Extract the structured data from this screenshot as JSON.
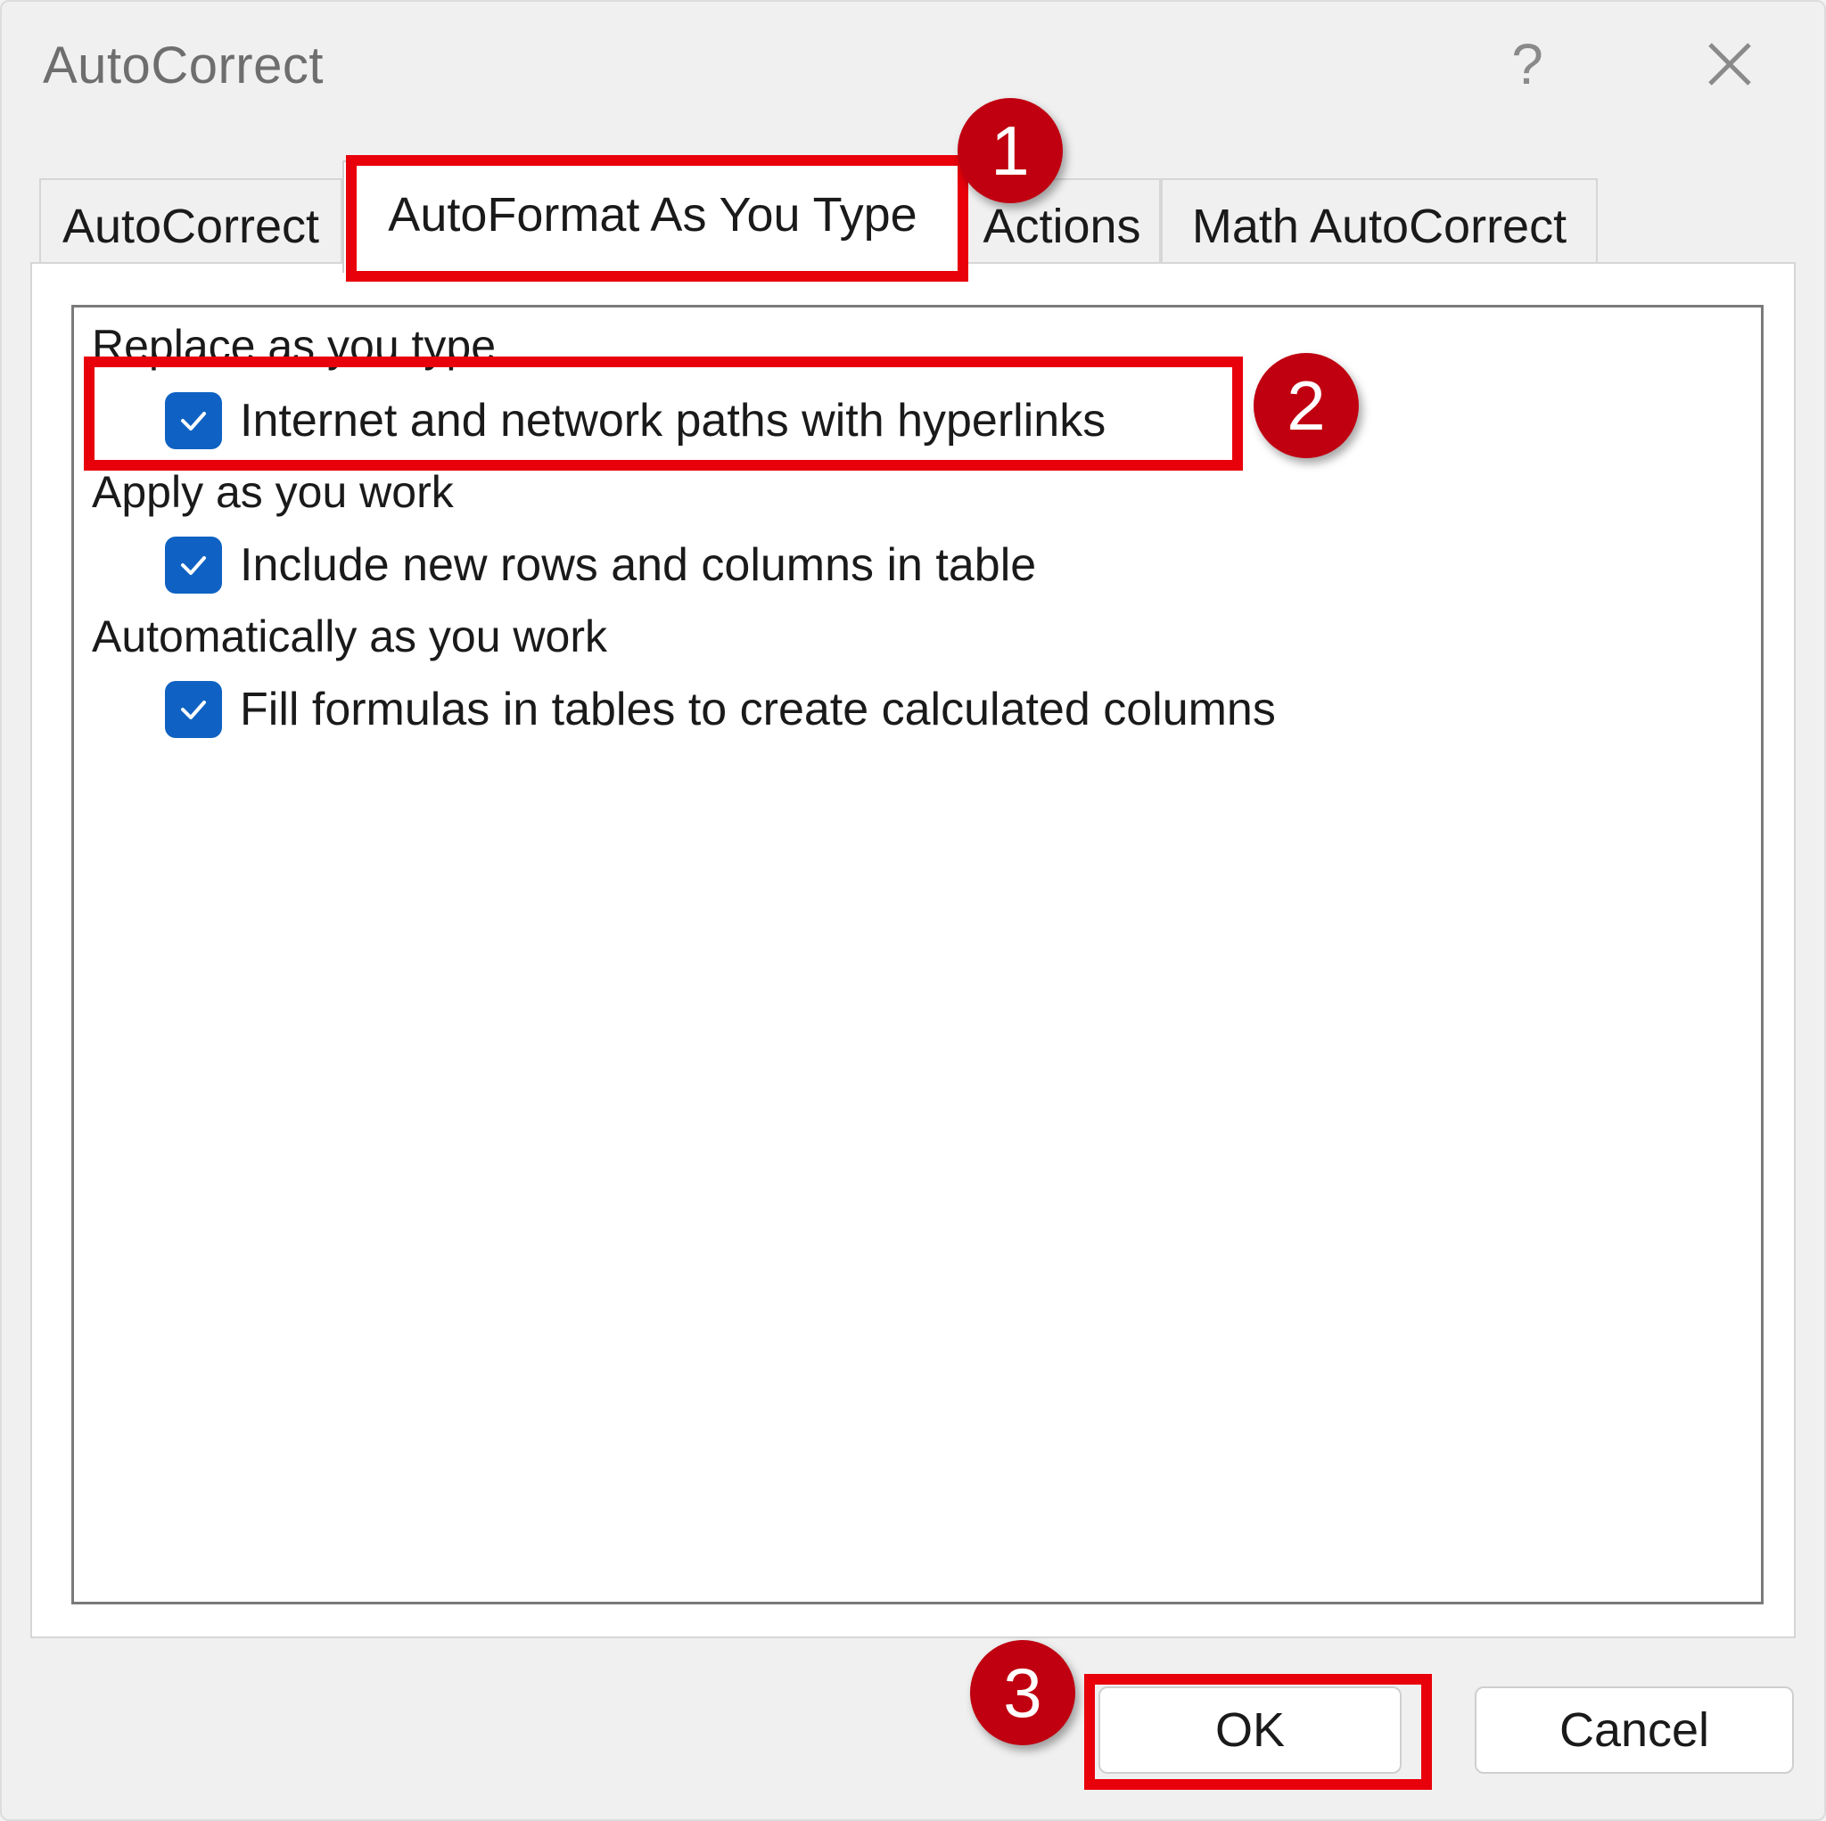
{
  "window": {
    "title": "AutoCorrect",
    "help_label": "?"
  },
  "tabs": [
    {
      "label": "AutoCorrect",
      "active": false
    },
    {
      "label": "AutoFormat As You Type",
      "active": true
    },
    {
      "label": "Actions",
      "active": false
    },
    {
      "label": "Math AutoCorrect",
      "active": false
    }
  ],
  "sections": [
    {
      "heading": "Replace as you type",
      "options": [
        {
          "label": "Internet and network paths with hyperlinks",
          "checked": true
        }
      ]
    },
    {
      "heading": "Apply as you work",
      "options": [
        {
          "label": "Include new rows and columns in table",
          "checked": true
        }
      ]
    },
    {
      "heading": "Automatically as you work",
      "options": [
        {
          "label": "Fill formulas in tables to create calculated columns",
          "checked": true
        }
      ]
    }
  ],
  "buttons": {
    "ok_label": "OK",
    "cancel_label": "Cancel"
  },
  "annotations": {
    "step1": "1",
    "step2": "2",
    "step3": "3",
    "highlight_color": "#e8000b",
    "badge_color": "#c00010"
  },
  "colors": {
    "checkbox_fill": "#0f62c3"
  }
}
